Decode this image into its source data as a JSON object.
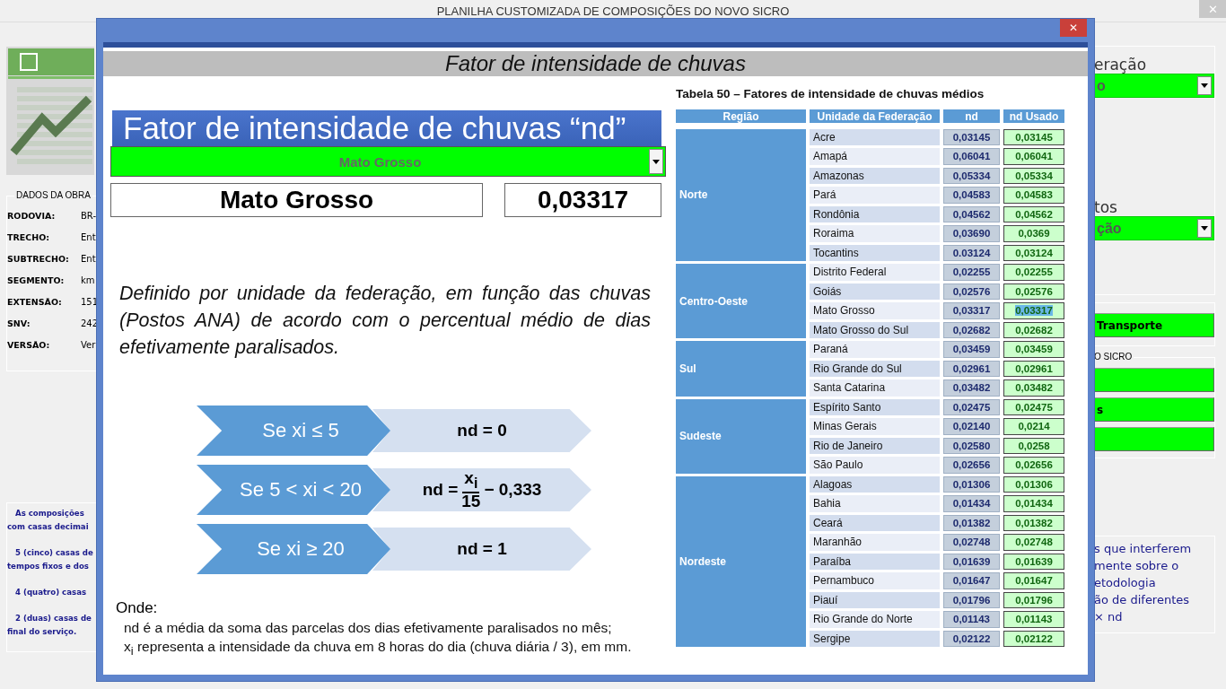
{
  "app": {
    "title": "PLANILHA CUSTOMIZADA DE COMPOSIÇÕES DO NOVO SICRO",
    "close": "✕",
    "obra": {
      "heading": "DADOS DA OBRA",
      "fields": [
        {
          "label": "RODOVIA:",
          "value": "BR-"
        },
        {
          "label": "TRECHO:",
          "value": "Ent"
        },
        {
          "label": "SUBTRECHO:",
          "value": "Ent"
        },
        {
          "label": "SEGMENTO:",
          "value": "km"
        },
        {
          "label": "EXTENSÃO:",
          "value": "151"
        },
        {
          "label": "SNV:",
          "value": "242"
        },
        {
          "label": "VERSÃO:",
          "value": "Ver"
        }
      ]
    },
    "notes": [
      [
        "As composições",
        "com casas decimai"
      ],
      [
        "5 (cinco) casas de",
        "tempos fixos e dos"
      ],
      [
        "4 (quatro) casas"
      ],
      [
        "2 (duas) casas de",
        "final do serviço."
      ]
    ],
    "right_panel": {
      "label_1": "eração",
      "select_1": "o",
      "label_2": "tos",
      "select_2": "ção",
      "transport_button": "Transporte",
      "group_label": "O SICRO",
      "buttons": [
        {
          "kind": "blank"
        },
        {
          "kind": "text",
          "label": "s"
        },
        {
          "kind": "blank"
        }
      ],
      "note_lines": [
        "s que interferem",
        "mente sobre o",
        "etodologia",
        "ão de diferentes",
        "× nd"
      ]
    }
  },
  "dialog": {
    "close": "✕",
    "title": "Fator de intensidade de chuvas",
    "banner": "Fator de intensidade de chuvas “nd”",
    "uf_select": {
      "value": "Mato Grosso"
    },
    "selected_name": "Mato Grosso",
    "selected_nd": "0,03317",
    "description": "Definido por unidade da federação, em função das chuvas (Postos ANA) de acordo com o percentual médio de dias efetivamente paralisados.",
    "rules": [
      {
        "condition": "Se xi ≤ 5",
        "kind": "plain",
        "result": "nd = 0"
      },
      {
        "condition": "Se 5 < xi < 20",
        "kind": "fraction",
        "prefix": "nd =",
        "numerator": "x$_{i}$",
        "denominator": "15",
        "suffix": "− 0,333"
      },
      {
        "condition": "Se xi ≥ 20",
        "kind": "plain",
        "result": "nd = 1"
      }
    ],
    "onde": {
      "label": "Onde:",
      "lines": [
        "nd é a média da soma das parcelas dos dias efetivamente paralisados no mês;",
        "x$_{i}$ representa a intensidade da chuva em 8 horas do dia (chuva diária / 3), em mm."
      ]
    },
    "table": {
      "title": "Tabela 50 – Fatores de intensidade de chuvas médios",
      "columns": [
        "Região",
        "Unidade da Federação",
        "nd",
        "nd Usado"
      ],
      "regions": [
        {
          "name": "Norte",
          "states": [
            {
              "name": "Acre",
              "nd": "0,03145",
              "nd_used": "0,03145",
              "selected": false
            },
            {
              "name": "Amapá",
              "nd": "0,06041",
              "nd_used": "0,06041",
              "selected": false
            },
            {
              "name": "Amazonas",
              "nd": "0,05334",
              "nd_used": "0,05334",
              "selected": false
            },
            {
              "name": "Pará",
              "nd": "0,04583",
              "nd_used": "0,04583",
              "selected": false
            },
            {
              "name": "Rondônia",
              "nd": "0,04562",
              "nd_used": "0,04562",
              "selected": false
            },
            {
              "name": "Roraima",
              "nd": "0,03690",
              "nd_used": "0,0369",
              "selected": false
            },
            {
              "name": "Tocantins",
              "nd": "0.03124",
              "nd_used": "0,03124",
              "selected": false
            }
          ]
        },
        {
          "name": "Centro-Oeste",
          "states": [
            {
              "name": "Distrito Federal",
              "nd": "0,02255",
              "nd_used": "0,02255",
              "selected": false
            },
            {
              "name": "Goiás",
              "nd": "0,02576",
              "nd_used": "0,02576",
              "selected": false
            },
            {
              "name": "Mato Grosso",
              "nd": "0,03317",
              "nd_used": "0,03317",
              "selected": true
            },
            {
              "name": "Mato Grosso do Sul",
              "nd": "0,02682",
              "nd_used": "0,02682",
              "selected": false
            }
          ]
        },
        {
          "name": "Sul",
          "states": [
            {
              "name": "Paraná",
              "nd": "0,03459",
              "nd_used": "0,03459",
              "selected": false
            },
            {
              "name": "Rio Grande do Sul",
              "nd": "0,02961",
              "nd_used": "0,02961",
              "selected": false
            },
            {
              "name": "Santa Catarina",
              "nd": "0,03482",
              "nd_used": "0,03482",
              "selected": false
            }
          ]
        },
        {
          "name": "Sudeste",
          "states": [
            {
              "name": "Espírito Santo",
              "nd": "0,02475",
              "nd_used": "0,02475",
              "selected": false
            },
            {
              "name": "Minas Gerais",
              "nd": "0,02140",
              "nd_used": "0,0214",
              "selected": false
            },
            {
              "name": "Rio de Janeiro",
              "nd": "0,02580",
              "nd_used": "0,0258",
              "selected": false
            },
            {
              "name": "São Paulo",
              "nd": "0,02656",
              "nd_used": "0,02656",
              "selected": false
            }
          ]
        },
        {
          "name": "Nordeste",
          "states": [
            {
              "name": "Alagoas",
              "nd": "0,01306",
              "nd_used": "0,01306",
              "selected": false
            },
            {
              "name": "Bahia",
              "nd": "0,01434",
              "nd_used": "0,01434",
              "selected": false
            },
            {
              "name": "Ceará",
              "nd": "0,01382",
              "nd_used": "0,01382",
              "selected": false
            },
            {
              "name": "Maranhão",
              "nd": "0,02748",
              "nd_used": "0,02748",
              "selected": false
            },
            {
              "name": "Paraíba",
              "nd": "0,01639",
              "nd_used": "0,01639",
              "selected": false
            },
            {
              "name": "Pernambuco",
              "nd": "0,01647",
              "nd_used": "0,01647",
              "selected": false
            },
            {
              "name": "Piauí",
              "nd": "0,01796",
              "nd_used": "0,01796",
              "selected": false
            },
            {
              "name": "Rio Grande do Norte",
              "nd": "0,01143",
              "nd_used": "0,01143",
              "selected": false
            },
            {
              "name": "Sergipe",
              "nd": "0,02122",
              "nd_used": "0,02122",
              "selected": false
            }
          ]
        }
      ]
    }
  }
}
